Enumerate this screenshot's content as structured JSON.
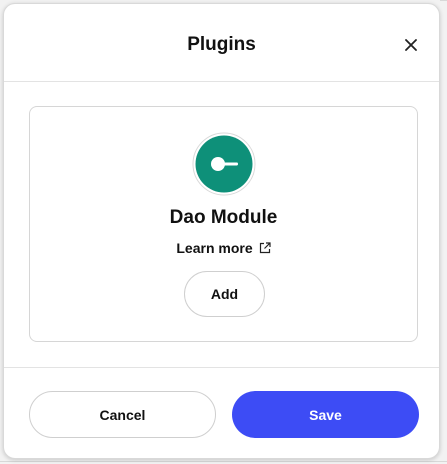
{
  "modal": {
    "title": "Plugins"
  },
  "plugin": {
    "name": "Dao Module",
    "learn_more_label": "Learn more",
    "add_label": "Add",
    "logo_icon": "dao-module-logo-icon",
    "logo_color": "#0e9079"
  },
  "footer": {
    "cancel_label": "Cancel",
    "save_label": "Save"
  },
  "colors": {
    "accent": "#3d4cf5",
    "plugin_logo": "#0e9079"
  }
}
